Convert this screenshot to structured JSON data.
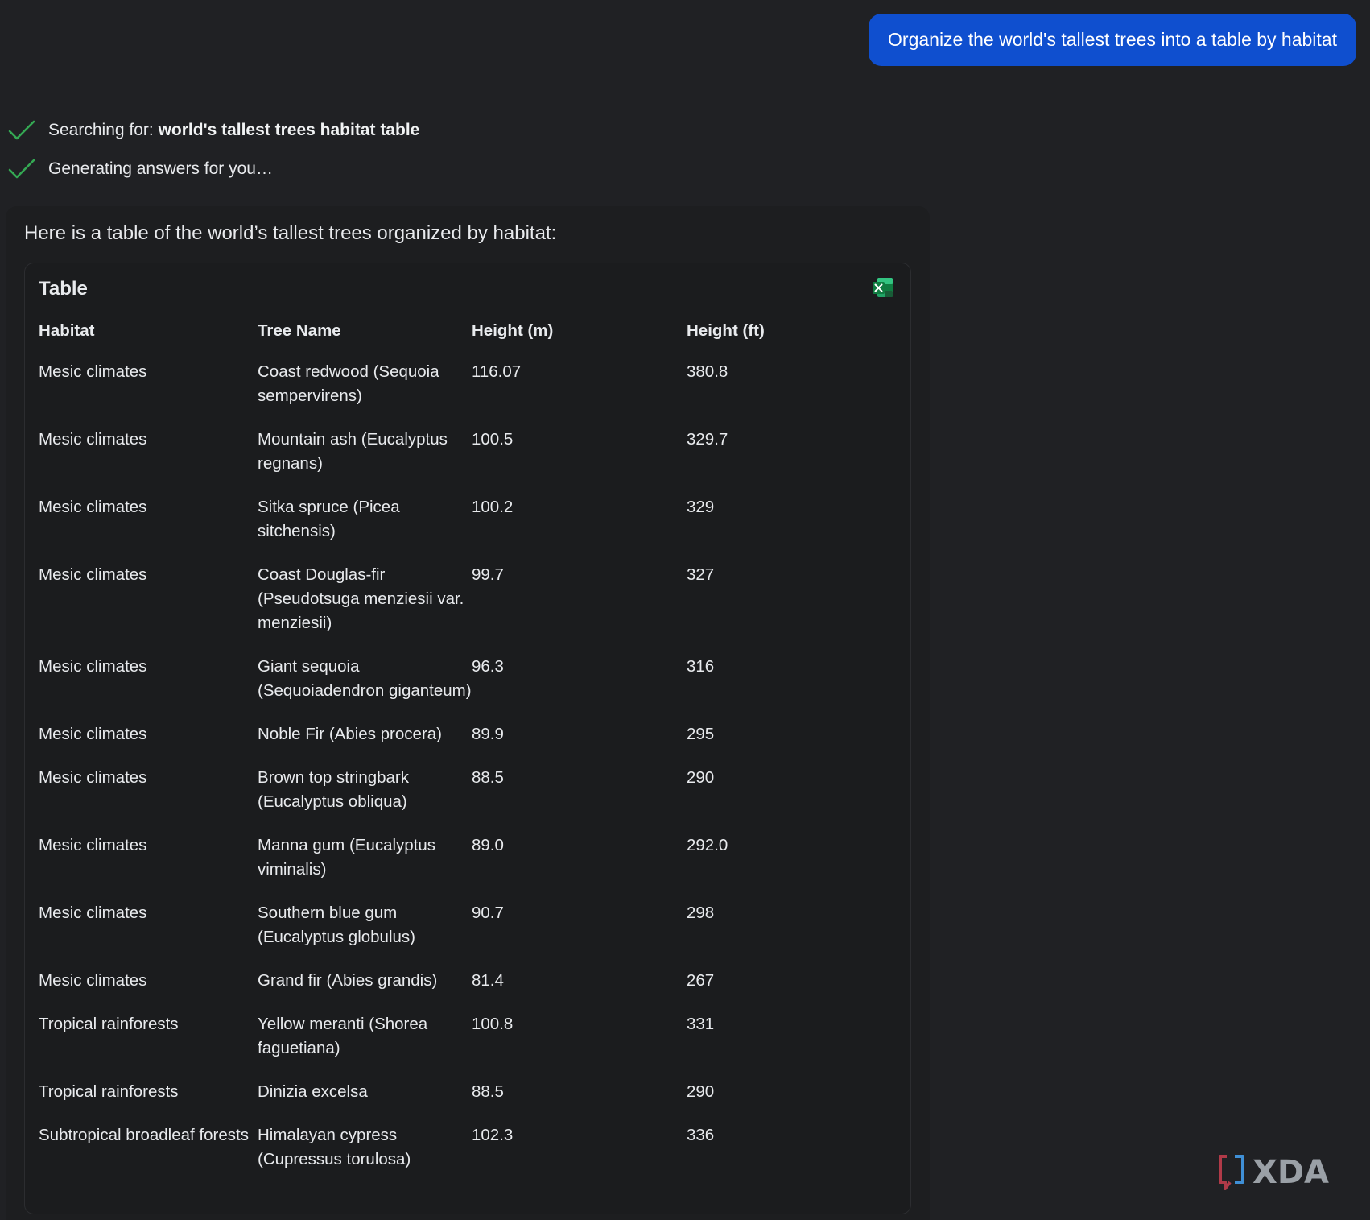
{
  "user_message": "Organize the world's tallest trees into a table by habitat",
  "status": [
    {
      "prefix": "Searching for: ",
      "query": "world's tallest trees habitat table"
    },
    {
      "prefix": "Generating answers for you…",
      "query": ""
    }
  ],
  "answer": {
    "intro": "Here is a table of the world’s tallest trees organized by habitat:",
    "table_title": "Table",
    "export_icon": "excel-icon",
    "columns": [
      "Habitat",
      "Tree Name",
      "Height (m)",
      "Height (ft)"
    ],
    "rows": [
      [
        "Mesic climates",
        "Coast redwood (Sequoia sempervirens)",
        "116.07",
        "380.8"
      ],
      [
        "Mesic climates",
        "Mountain ash (Eucalyptus regnans)",
        "100.5",
        "329.7"
      ],
      [
        "Mesic climates",
        "Sitka spruce (Picea sitchensis)",
        "100.2",
        "329"
      ],
      [
        "Mesic climates",
        "Coast Douglas-fir (Pseudotsuga menziesii var. menziesii)",
        "99.7",
        "327"
      ],
      [
        "Mesic climates",
        "Giant sequoia (Sequoiadendron giganteum)",
        "96.3",
        "316"
      ],
      [
        "Mesic climates",
        "Noble Fir (Abies procera)",
        "89.9",
        "295"
      ],
      [
        "Mesic climates",
        "Brown top stringbark (Eucalyptus obliqua)",
        "88.5",
        "290"
      ],
      [
        "Mesic climates",
        "Manna gum (Eucalyptus viminalis)",
        "89.0",
        "292.0"
      ],
      [
        "Mesic climates",
        "Southern blue gum (Eucalyptus globulus)",
        "90.7",
        "298"
      ],
      [
        "Mesic climates",
        "Grand fir (Abies grandis)",
        "81.4",
        "267"
      ],
      [
        "Tropical rainforests",
        "Yellow meranti (Shorea faguetiana)",
        "100.8",
        "331"
      ],
      [
        "Tropical rainforests",
        "Dinizia excelsa",
        "88.5",
        "290"
      ],
      [
        "Subtropical broadleaf forests",
        "Himalayan cypress (Cupressus torulosa)",
        "102.3",
        "336"
      ]
    ]
  },
  "watermark": "XDA",
  "colors": {
    "background": "#202124",
    "user_bubble": "#0f4fcf",
    "check": "#34a853"
  }
}
